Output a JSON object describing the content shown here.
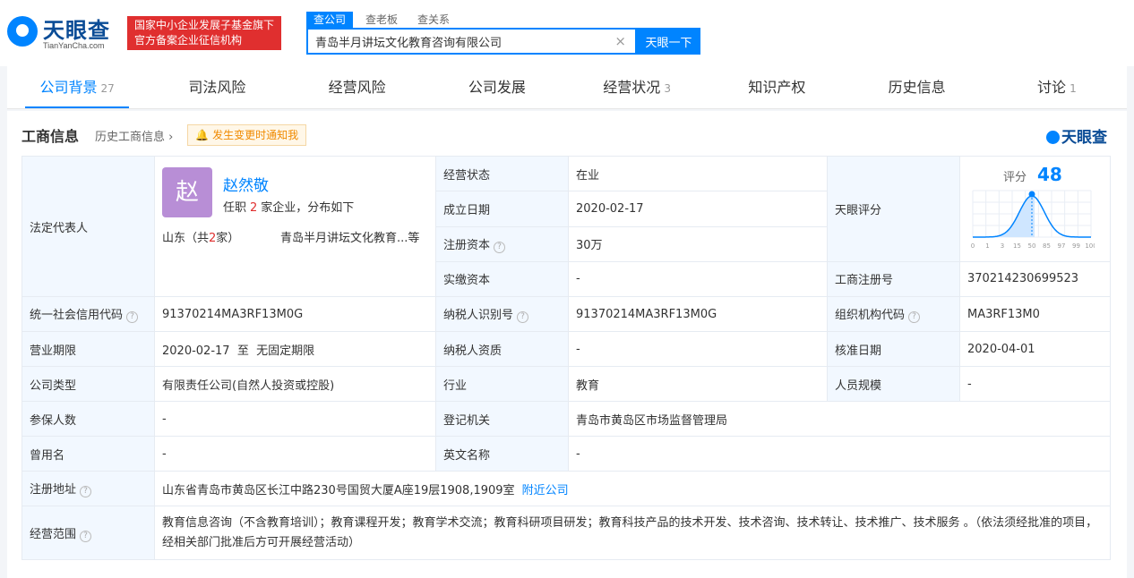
{
  "logo": {
    "name": "天眼查",
    "domain": "TianYanCha.com"
  },
  "badge": {
    "line1": "国家中小企业发展子基金旗下",
    "line2": "官方备案企业征信机构"
  },
  "search": {
    "tabs": [
      "查公司",
      "查老板",
      "查关系"
    ],
    "value": "青岛半月讲坛文化教育咨询有限公司",
    "clear": "×",
    "button": "天眼一下"
  },
  "nav": [
    {
      "label": "公司背景",
      "count": "27"
    },
    {
      "label": "司法风险",
      "count": ""
    },
    {
      "label": "经营风险",
      "count": ""
    },
    {
      "label": "公司发展",
      "count": ""
    },
    {
      "label": "经营状况",
      "count": "3"
    },
    {
      "label": "知识产权",
      "count": ""
    },
    {
      "label": "历史信息",
      "count": ""
    },
    {
      "label": "讨论",
      "count": "1"
    }
  ],
  "section": {
    "title": "工商信息",
    "history": "历史工商信息",
    "history_arrow": "›",
    "notify": "发生变更时通知我",
    "brand": "天眼查"
  },
  "rep": {
    "label": "法定代表人",
    "avatar": "赵",
    "name": "赵然敬",
    "sub_pre": "任职",
    "count": "2",
    "sub_post": "家企业，分布如下",
    "area_pre": "山东（共",
    "area_count": "2",
    "area_post": "家）",
    "company": "青岛半月讲坛文化教育...等"
  },
  "rows": {
    "status_l": "经营状态",
    "status_v": "在业",
    "found_l": "成立日期",
    "found_v": "2020-02-17",
    "capital_l": "注册资本",
    "capital_v": "30万",
    "paid_l": "实缴资本",
    "paid_v": "-",
    "score_l": "天眼评分",
    "regno_l": "工商注册号",
    "regno_v": "370214230699523",
    "credit_l": "统一社会信用代码",
    "credit_v": "91370214MA3RF13M0G",
    "taxid_l": "纳税人识别号",
    "taxid_v": "91370214MA3RF13M0G",
    "org_l": "组织机构代码",
    "org_v": "MA3RF13M0",
    "term_l": "营业期限",
    "term_v": "2020-02-17  至  无固定期限",
    "taxq_l": "纳税人资质",
    "taxq_v": "-",
    "approve_l": "核准日期",
    "approve_v": "2020-04-01",
    "type_l": "公司类型",
    "type_v": "有限责任公司(自然人投资或控股)",
    "industry_l": "行业",
    "industry_v": "教育",
    "staff_l": "人员规模",
    "staff_v": "-",
    "insured_l": "参保人数",
    "insured_v": "-",
    "authority_l": "登记机关",
    "authority_v": "青岛市黄岛区市场监督管理局",
    "former_l": "曾用名",
    "former_v": "-",
    "english_l": "英文名称",
    "english_v": "-",
    "address_l": "注册地址",
    "address_v": "山东省青岛市黄岛区长江中路230号国贸大厦A座19层1908,1909室",
    "address_link": "附近公司",
    "scope_l": "经营范围",
    "scope_v": "教育信息咨询（不含教育培训）；教育课程开发；教育学术交流；教育科研项目研发；教育科技产品的技术开发、技术咨询、技术转让、技术推广、技术服务 。（依法须经批准的项目，经相关部门批准后方可开展经营活动）"
  },
  "score": {
    "label": "评分",
    "value": 48,
    "ticks": [
      "0",
      "1",
      "3",
      "15",
      "50",
      "85",
      "97",
      "99",
      "100"
    ],
    "colors": {
      "curve": "#0084ff",
      "fill": "#cfe6ff",
      "grid": "#e8eef5"
    }
  },
  "help_icon": "?"
}
